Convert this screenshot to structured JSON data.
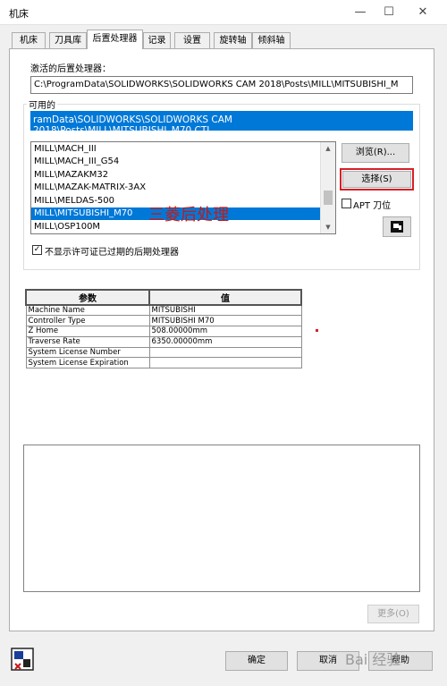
{
  "window": {
    "title": "机床",
    "minimize": "—",
    "maximize": "☐",
    "close": "✕"
  },
  "tabs": [
    {
      "label": "机床",
      "active": false
    },
    {
      "label": "刀具库",
      "active": false
    },
    {
      "label": "后置处理器",
      "active": true
    },
    {
      "label": "记录",
      "active": false
    },
    {
      "label": "设置",
      "active": false
    },
    {
      "label": "旋转轴",
      "active": false
    },
    {
      "label": "倾斜轴",
      "active": false
    }
  ],
  "post": {
    "active_label": "激活的后置处理器：",
    "active_value": "C:\\ProgramData\\SOLIDWORKS\\SOLIDWORKS CAM 2018\\Posts\\MILL\\MITSUBISHI_M",
    "available_label": "可用的",
    "available_value": "ramData\\SOLIDWORKS\\SOLIDWORKS CAM 2018\\Posts\\MILL\\MITSUBISHI_M70.CTL",
    "list": [
      {
        "label": "MILL\\MACH_III",
        "selected": false
      },
      {
        "label": "MILL\\MACH_III_G54",
        "selected": false
      },
      {
        "label": "MILL\\MAZAKM32",
        "selected": false
      },
      {
        "label": "MILL\\MAZAK-MATRIX-3AX",
        "selected": false
      },
      {
        "label": "MILL\\MELDAS-500",
        "selected": false
      },
      {
        "label": "MILL\\MITSUBISHI_M70",
        "selected": true
      },
      {
        "label": "MILL\\OSP100M",
        "selected": false
      }
    ],
    "scroll_up": "▲",
    "scroll_down": "▼",
    "browse_label": "浏览(R)...",
    "select_label": "选择(S)",
    "apt_label": "APT 刀位",
    "apt_checked": false,
    "hide_expired_label": "不显示许可证已过期的后期处理器",
    "hide_expired_checked": true,
    "check_mark": "✓",
    "more_label": "更多(O)",
    "annotation": "三菱后处理",
    "highlight_color": "#d62027",
    "selection_color": "#0078d7"
  },
  "params_table": {
    "headers": [
      "参数",
      "值"
    ],
    "rows": [
      [
        "Machine Name",
        "MITSUBISHI"
      ],
      [
        "Controller Type",
        "MITSUBISHI M70"
      ],
      [
        "Z Home",
        "508.00000mm"
      ],
      [
        "Traverse Rate",
        "6350.00000mm"
      ],
      [
        "System License Number",
        ""
      ],
      [
        "System License Expiration",
        ""
      ]
    ]
  },
  "footer": {
    "ok_label": "确定",
    "cancel_label": "取消",
    "help_label": "帮助"
  },
  "icons": {
    "apt_icon": "apt-setup-icon",
    "machine_icon": "machine-setup-icon"
  },
  "watermark": "Bai 经验"
}
